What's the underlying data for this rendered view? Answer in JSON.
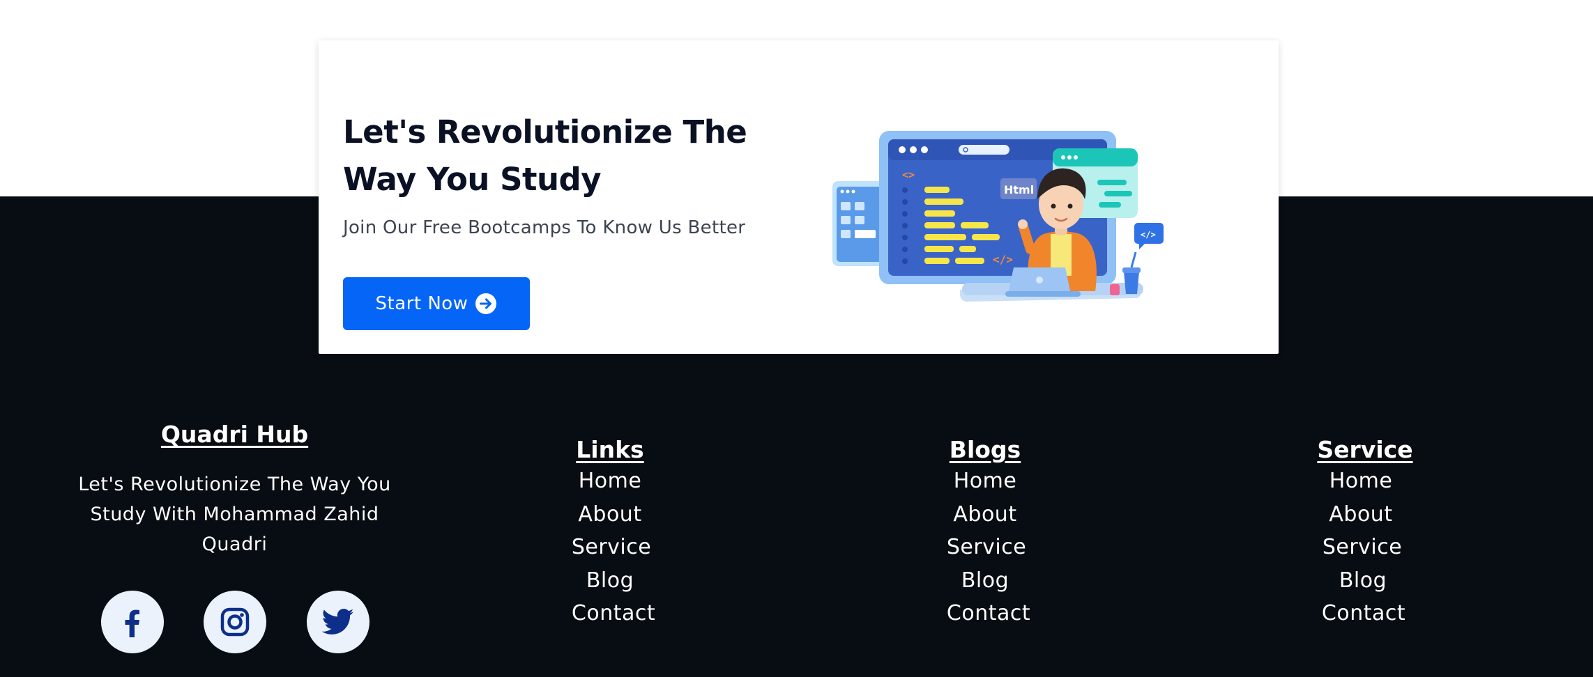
{
  "cta": {
    "title": "Let's Revolutionize The Way You Study",
    "subtitle": "Join Our Free Bootcamps To Know Us Better",
    "button_label": "Start Now"
  },
  "illustration": {
    "code_tag_left": "<>",
    "html_badge": "Html",
    "code_tag_bottom": "</>",
    "code_tag_right": "</>"
  },
  "footer": {
    "brand": {
      "title": "Quadri Hub",
      "description": "Let's Revolutionize The Way You Study With Mohammad Zahid Quadri"
    },
    "social": [
      "facebook-icon",
      "instagram-icon",
      "twitter-icon"
    ],
    "columns": [
      {
        "title": "Links",
        "items": [
          "Home",
          "About",
          "Service",
          "Blog",
          "Contact"
        ]
      },
      {
        "title": "Blogs",
        "items": [
          "Home",
          "About",
          "Service",
          "Blog",
          "Contact"
        ]
      },
      {
        "title": "Service",
        "items": [
          "Home",
          "About",
          "Service",
          "Blog",
          "Contact"
        ]
      }
    ]
  },
  "colors": {
    "footer_bg": "#070d12",
    "accent": "#0565f7",
    "social_bg": "#ebf2fb",
    "social_icon": "#0d2f8a",
    "title_text": "#0b1124"
  }
}
